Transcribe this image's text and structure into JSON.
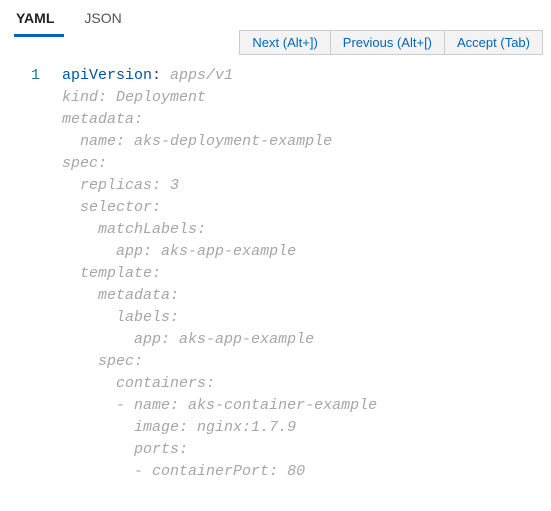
{
  "tabs": [
    {
      "label": "YAML",
      "active": true
    },
    {
      "label": "JSON",
      "active": false
    }
  ],
  "suggestions": {
    "next": "Next (Alt+])",
    "previous": "Previous (Alt+[)",
    "accept": "Accept (Tab)"
  },
  "line_number": "1",
  "code": {
    "line1_key": "apiVersion",
    "line1_val": "apps/v1",
    "ghost_lines": [
      {
        "indent": 0,
        "key": "kind",
        "val": "Deployment"
      },
      {
        "indent": 0,
        "key": "metadata",
        "val": ""
      },
      {
        "indent": 1,
        "key": "name",
        "val": "aks-deployment-example"
      },
      {
        "indent": 0,
        "key": "spec",
        "val": ""
      },
      {
        "indent": 1,
        "key": "replicas",
        "val": "3"
      },
      {
        "indent": 1,
        "key": "selector",
        "val": ""
      },
      {
        "indent": 2,
        "key": "matchLabels",
        "val": ""
      },
      {
        "indent": 3,
        "key": "app",
        "val": "aks-app-example"
      },
      {
        "indent": 1,
        "key": "template",
        "val": ""
      },
      {
        "indent": 2,
        "key": "metadata",
        "val": ""
      },
      {
        "indent": 3,
        "key": "labels",
        "val": ""
      },
      {
        "indent": 4,
        "key": "app",
        "val": "aks-app-example"
      },
      {
        "indent": 2,
        "key": "spec",
        "val": ""
      },
      {
        "indent": 3,
        "key": "containers",
        "val": ""
      },
      {
        "indent": 3,
        "prefix": "- ",
        "key": "name",
        "val": "aks-container-example"
      },
      {
        "indent": 4,
        "key": "image",
        "val": "nginx:1.7.9"
      },
      {
        "indent": 4,
        "key": "ports",
        "val": ""
      },
      {
        "indent": 4,
        "prefix": "- ",
        "key": "containerPort",
        "val": "80"
      }
    ]
  }
}
